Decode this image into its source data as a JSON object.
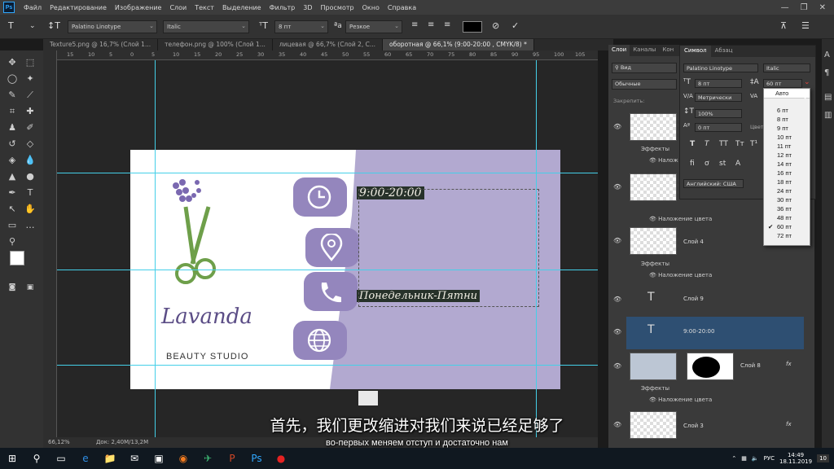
{
  "app": {
    "logo": "Ps",
    "accent": "#31a8ff"
  },
  "menu": [
    "Файл",
    "Редактирование",
    "Изображение",
    "Слои",
    "Текст",
    "Выделение",
    "Фильтр",
    "3D",
    "Просмотр",
    "Окно",
    "Справка"
  ],
  "window_controls": [
    "—",
    "❐",
    "✕"
  ],
  "options": {
    "font_family": "Palatino Linotype",
    "font_style": "Italic",
    "font_size": "8 пт",
    "antialias": "Резкое",
    "text_color": "#000000"
  },
  "tabs": [
    {
      "label": "Texture5.png @ 16,7% (Слой 1...",
      "active": false
    },
    {
      "label": "телефон.png @ 100% (Слой 1...",
      "active": false
    },
    {
      "label": "лицевая @ 66,7% (Слой 2, С...",
      "active": false
    },
    {
      "label": "оборотная @ 66,1% (9:00-20:00 , CMYK/8) *",
      "active": true
    }
  ],
  "ruler_labels": [
    "15",
    "10",
    "5",
    "0",
    "5",
    "10",
    "15",
    "20",
    "25",
    "30",
    "35",
    "40",
    "45",
    "50",
    "55",
    "60",
    "65",
    "70",
    "75",
    "80",
    "85",
    "90",
    "95",
    "100",
    "105"
  ],
  "card": {
    "brand_name": "Lavanda",
    "brand_sub": "Beauty Studio",
    "hours_text": "9:00-20:00",
    "days_text": "Понедельник-Пятни",
    "lavender_color": "#b2a9d0",
    "tile_color": "#9486bd"
  },
  "status": {
    "zoom": "66,12%",
    "doc": "Док: 2,40M/13,2M"
  },
  "layers_panel": {
    "tabs": [
      "Слои",
      "Каналы",
      "Кон"
    ],
    "search_placeholder": "Вид",
    "blend_mode": "Обычные",
    "lock_label": "Закрепить:",
    "rows": [
      {
        "name": "",
        "type": "thumb"
      },
      {
        "name": "",
        "type": "thumb"
      },
      {
        "name": "Слой 4",
        "type": "thumb"
      },
      {
        "name": "Слой 9",
        "type": "text"
      },
      {
        "name": "9:00-20:00",
        "type": "text",
        "selected": true
      },
      {
        "name": "Слой 8",
        "type": "masked"
      },
      {
        "name": "Слой 3",
        "type": "thumb"
      }
    ],
    "effects_label": "Эффекты",
    "color_overlay_label": "Наложение цвета",
    "color_overlay_short": "Налож",
    "fx_label": "fx"
  },
  "character_panel": {
    "tabs": [
      "Символ",
      "Абзац"
    ],
    "font_family": "Palatino Linotype",
    "font_style": "Italic",
    "size": "8 пт",
    "leading": "60 пт",
    "kerning": "Метрически",
    "vertical_scale": "100%",
    "baseline": "0 пт",
    "color_label": "Цвет:",
    "language": "Английский: США",
    "style_buttons": [
      "T",
      "T",
      "TT",
      "Tт",
      "T¹",
      "T,",
      "T",
      "T"
    ],
    "feature_buttons": [
      "fi",
      "ơ",
      "st",
      "A"
    ]
  },
  "leading_dropdown": {
    "items": [
      "Авто",
      "6 пт",
      "8 пт",
      "9 пт",
      "10 пт",
      "11 пт",
      "12 пт",
      "14 пт",
      "16 пт",
      "18 пт",
      "24 пт",
      "30 пт",
      "36 пт",
      "48 пт",
      "60 пт",
      "72 пт"
    ],
    "selected": "60 пт"
  },
  "subtitles": {
    "chinese": "首先，我们更改缩进对我们来说已经足够了",
    "russian": "во-первых меняем отступ и достаточно нам"
  },
  "taskbar": {
    "language": "РУС",
    "time": "14:49",
    "date": "18.11.2019",
    "notifications": "10"
  }
}
